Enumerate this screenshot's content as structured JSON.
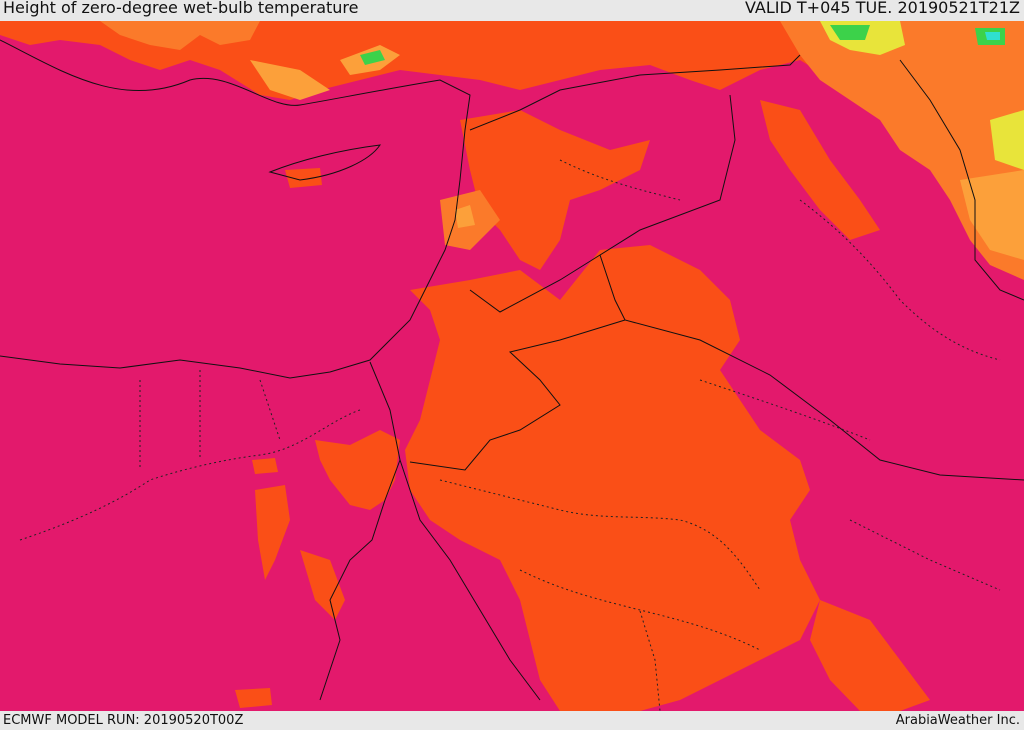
{
  "header": {
    "title": "Height of zero-degree wet-bulb temperature",
    "valid": "VALID T+045 TUE. 20190521T21Z"
  },
  "footer": {
    "model_run": "ECMWF MODEL RUN: 20190520T00Z",
    "credit": "ArabiaWeather Inc."
  },
  "colors": {
    "magenta": "#e3196c",
    "orange_red": "#fa4f17",
    "orange": "#fb7a2a",
    "light_orange": "#fca03a",
    "yellow": "#e8e43a",
    "green": "#3cd24a",
    "cyan": "#2fe0d0",
    "border": "#111111"
  }
}
